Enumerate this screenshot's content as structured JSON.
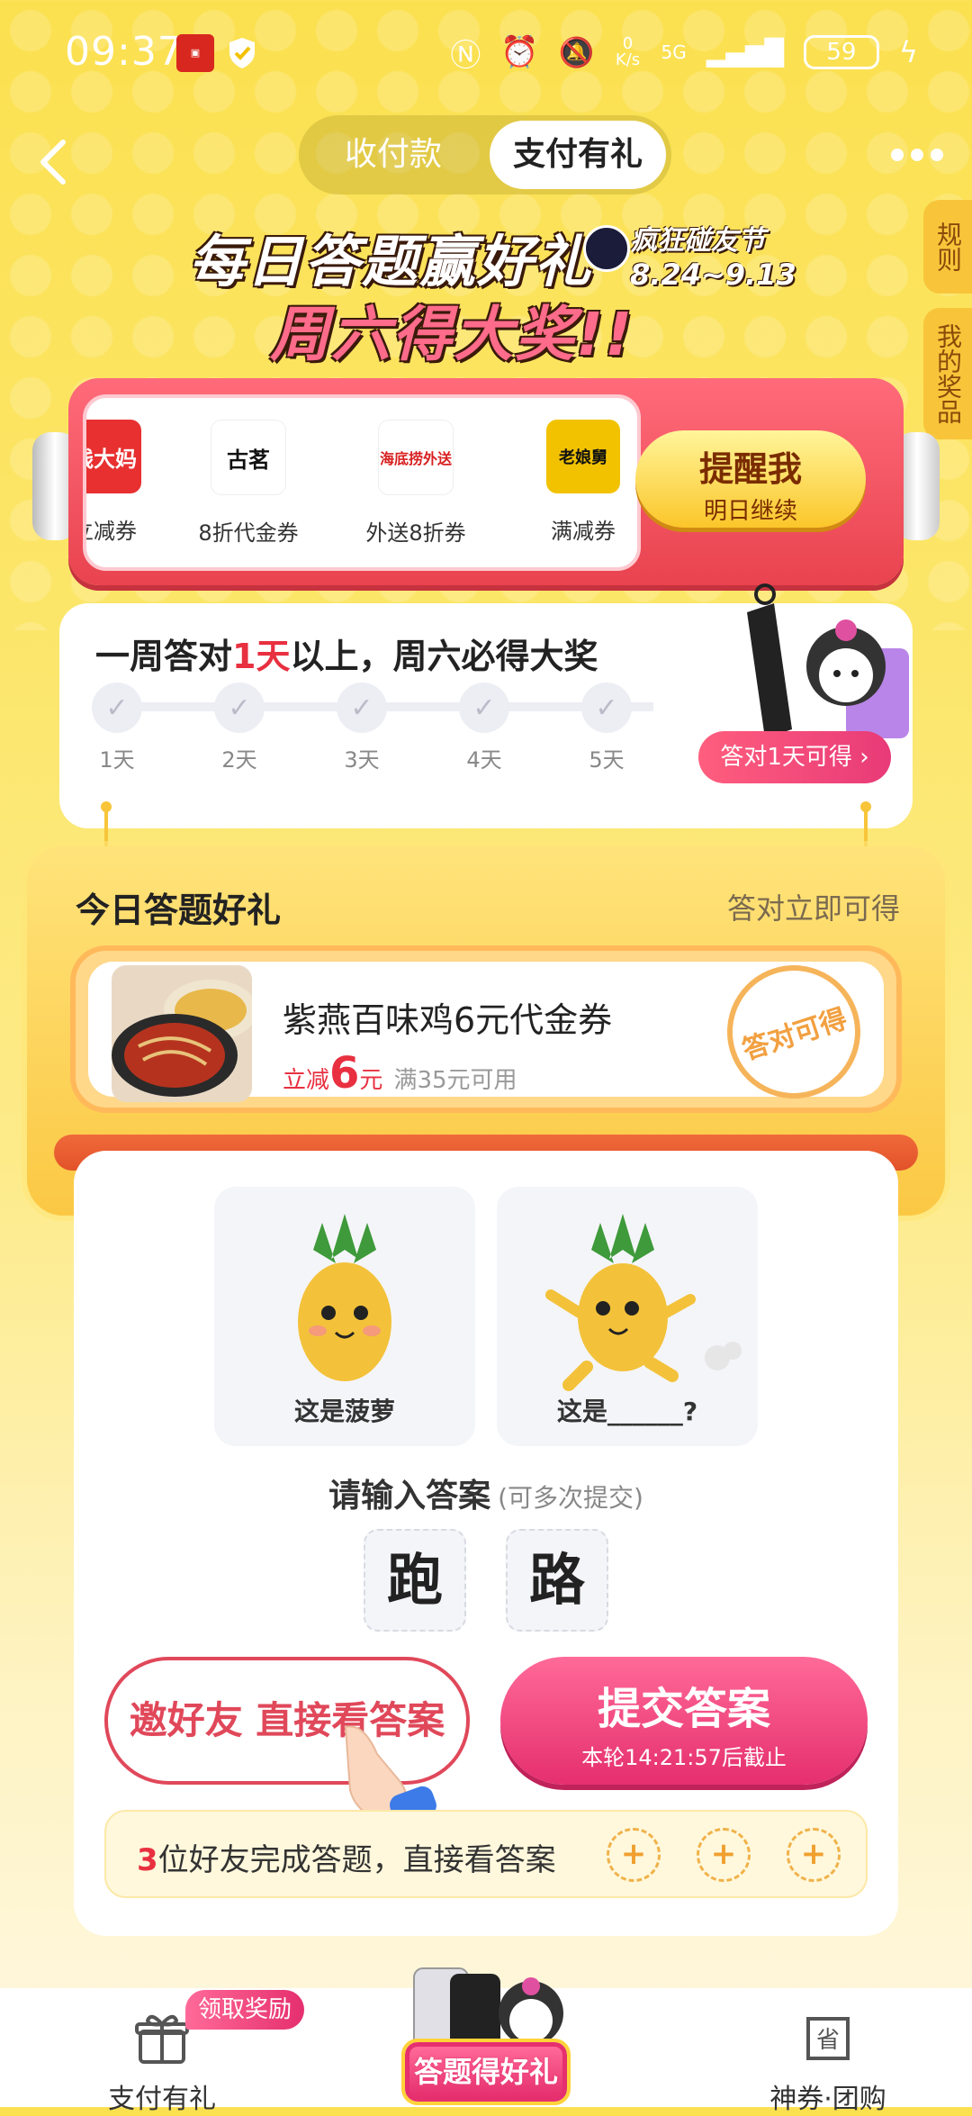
{
  "status_bar": {
    "time": "09:37",
    "net_speed": "0 K/s",
    "network": "5G",
    "battery": "59"
  },
  "header": {
    "tabs": [
      {
        "label": "收付款",
        "active": false
      },
      {
        "label": "支付有礼",
        "active": true
      }
    ]
  },
  "side_tabs": {
    "rules": "规则",
    "my_prizes": "我的奖品"
  },
  "banner": {
    "line1": "每日答题赢好礼",
    "line2": "周六得大奖!!",
    "festival_name": "疯狂碰友节",
    "festival_dates": "8.24~9.13"
  },
  "coupons": {
    "items": [
      {
        "brand": "钱大妈",
        "caption": "立减券",
        "color": "#E83030"
      },
      {
        "brand": "古茗",
        "caption": "8折代金券",
        "color": "#111111"
      },
      {
        "brand": "海底捞外送",
        "caption": "外送8折券",
        "color": "#D82020"
      },
      {
        "brand": "老娘舅",
        "caption": "满减券",
        "color": "#F2C200"
      }
    ],
    "remind_title": "提醒我",
    "remind_sub": "明日继续"
  },
  "weekly": {
    "title_pre": "一周答对",
    "title_highlight": "1天",
    "title_post": "以上，周六必得大奖",
    "days": [
      "1天",
      "2天",
      "3天",
      "4天",
      "5天"
    ],
    "check_glyph": "✓",
    "prize_button": "答对1天可得 ›"
  },
  "today": {
    "title": "今日答题好礼",
    "subtitle": "答对立即可得",
    "gift_name": "紫燕百味鸡6元代金券",
    "price_prefix": "立减",
    "price_value": "6",
    "price_unit": "元",
    "condition": "满35元可用",
    "stamp": "答对可得"
  },
  "question": {
    "image1_caption": "这是菠萝",
    "image2_caption": "这是______?",
    "prompt": "请输入答案",
    "prompt_hint": "(可多次提交)",
    "tiles": [
      "跑",
      "路"
    ],
    "invite_button": "邀好友 直接看答案",
    "submit_title": "提交答案",
    "submit_sub": "本轮14:21:57后截止",
    "friends_count": "3",
    "friends_text": "位好友完成答题，直接看答案",
    "plus_glyph": "+"
  },
  "nav": {
    "left_label": "支付有礼",
    "left_badge": "领取奖励",
    "center_label": "答题得好礼",
    "right_label": "神券·团购",
    "right_icon_text": "省"
  }
}
